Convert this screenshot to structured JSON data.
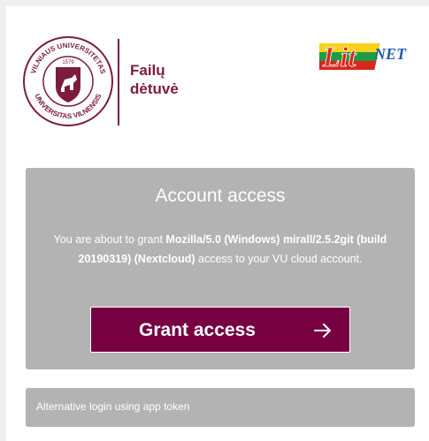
{
  "header": {
    "brand_line1": "Failų",
    "brand_line2": "dėtuvė",
    "seal_text_top": "VILNIAUS UNIVERSITETAS",
    "seal_text_bottom": "UNIVERSITAS VILNENSIS",
    "seal_year": "1579",
    "partner_logo_text": "NET",
    "partner_logo_prefix": "Lit"
  },
  "card": {
    "title": "Account access",
    "text_prefix": "You are about to grant ",
    "client_name": "Mozilla/5.0 (Windows) mirall/2.5.2git (build 20190319) (Nextcloud)",
    "text_suffix": " access to your VU cloud account.",
    "grant_label": "Grant access",
    "grant_icon": "arrow-right-icon"
  },
  "alt_login": {
    "label": "Alternative login using app token"
  },
  "colors": {
    "brand": "#7b1c3c",
    "button": "#770041",
    "card_bg": "#b3b3b3",
    "page_bg": "#efefef"
  }
}
